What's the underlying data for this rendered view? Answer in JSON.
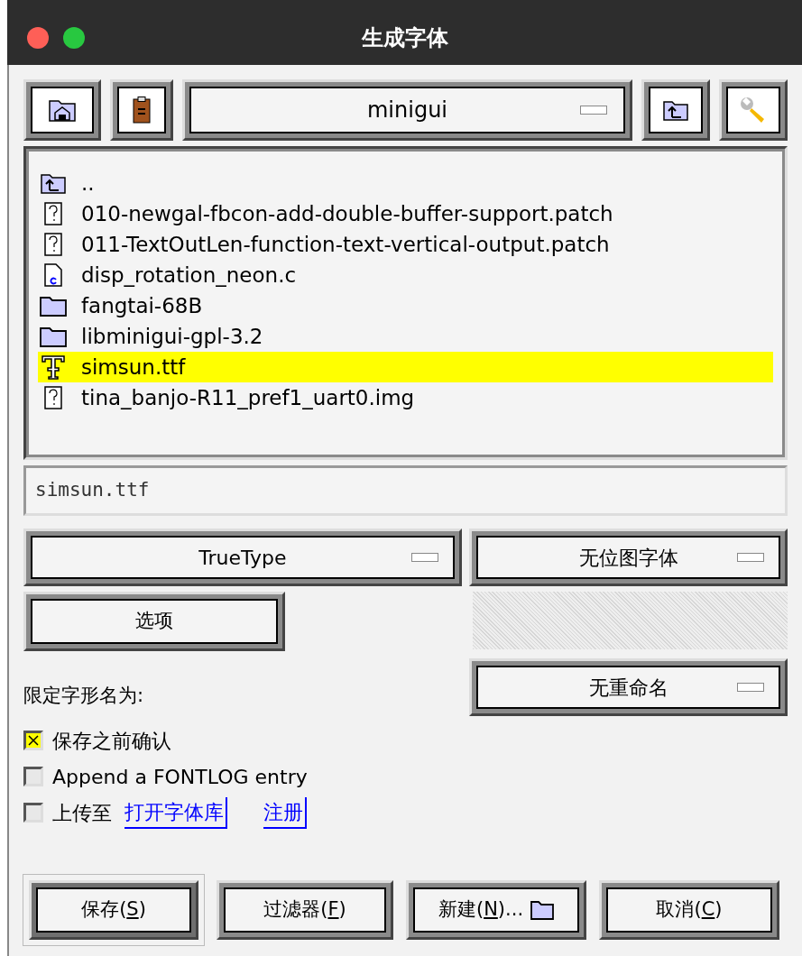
{
  "window": {
    "title": "生成字体"
  },
  "toolbar": {
    "directory": "minigui"
  },
  "files": [
    {
      "name": "..",
      "kind": "parent",
      "selected": false
    },
    {
      "name": "010-newgal-fbcon-add-double-buffer-support.patch",
      "kind": "unknown",
      "selected": false
    },
    {
      "name": "011-TextOutLen-function-text-vertical-output.patch",
      "kind": "unknown",
      "selected": false
    },
    {
      "name": "disp_rotation_neon.c",
      "kind": "c_source",
      "selected": false
    },
    {
      "name": "fangtai-68B",
      "kind": "folder",
      "selected": false
    },
    {
      "name": "libminigui-gpl-3.2",
      "kind": "folder",
      "selected": false
    },
    {
      "name": "simsun.ttf",
      "kind": "font",
      "selected": true
    },
    {
      "name": "tina_banjo-R11_pref1_uart0.img",
      "kind": "unknown",
      "selected": false
    }
  ],
  "filename": {
    "value": "simsun.ttf"
  },
  "format": "TrueType",
  "bitmap": "无位图字体",
  "options_button": "选项",
  "glyph_name_label": "限定字形名为:",
  "rename": "无重命名",
  "checkboxes": [
    {
      "label": "保存之前确认",
      "checked": true
    },
    {
      "label": "Append a FONTLOG entry",
      "checked": false
    },
    {
      "label": "上传至",
      "checked": false,
      "links": [
        "打开字体库",
        "注册"
      ]
    }
  ],
  "buttons": [
    {
      "before": "保存(",
      "mnemonic": "S",
      "after": ")",
      "default": true,
      "icon": false
    },
    {
      "before": "过滤器(",
      "mnemonic": "F",
      "after": ")",
      "default": false,
      "icon": false
    },
    {
      "before": "新建(",
      "mnemonic": "N",
      "after": ")...",
      "default": false,
      "icon": true
    },
    {
      "before": "取消(",
      "mnemonic": "C",
      "after": ")",
      "default": false,
      "icon": false
    }
  ]
}
